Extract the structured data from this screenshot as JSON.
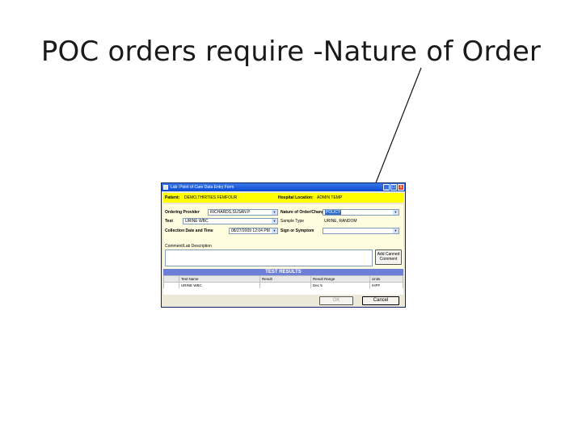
{
  "slide": {
    "title": "POC orders require -Nature of Order"
  },
  "window": {
    "title": "Lab: Point of Care Data Entry Form",
    "controls": {
      "minimize": "_",
      "maximize": "□",
      "close": "x"
    }
  },
  "patient_bar": {
    "patient_label": "Patient:",
    "patient_value": "DEMO,THIRTIES FEMFOUR",
    "location_label": "Hospital Location:",
    "location_value": "ADMIN TEMP"
  },
  "form": {
    "ordering_provider_label": "Ordering Provider",
    "ordering_provider_value": "RICHARDS,SUSAN P",
    "test_label": "Test",
    "test_value": "URINE WBC",
    "collection_label": "Collection Date and Time",
    "collection_value": "08/27/2009 12:04 PM",
    "nature_label": "Nature of Order/Change",
    "nature_value": "POLICY",
    "sample_type_label": "Sample Type",
    "sample_type_value": "URINE, RANDOM",
    "sign_symptom_label": "Sign or Symptom",
    "sign_symptom_value": "",
    "comment_label": "Comment/Lab Description",
    "add_comment_button": "Add Canned Comment"
  },
  "results": {
    "header": "TEST RESULTS",
    "columns": [
      "",
      "Test Name",
      "Result",
      "Result Range",
      "Units"
    ],
    "rows": [
      {
        "marker": "",
        "test_name": "URINE WBC",
        "result": "",
        "range": "Dec 5",
        "units": "/HPF"
      }
    ]
  },
  "footer": {
    "ok_button": "OK",
    "cancel_button": "Cancel"
  },
  "colors": {
    "highlight": "#ffff00",
    "title_bar": "#0a4ad0",
    "results_header": "#6d7fd6",
    "selection": "#316ac5"
  },
  "icons": {
    "window_icon": "app-icon",
    "dropdown": "chevron-down-icon"
  }
}
